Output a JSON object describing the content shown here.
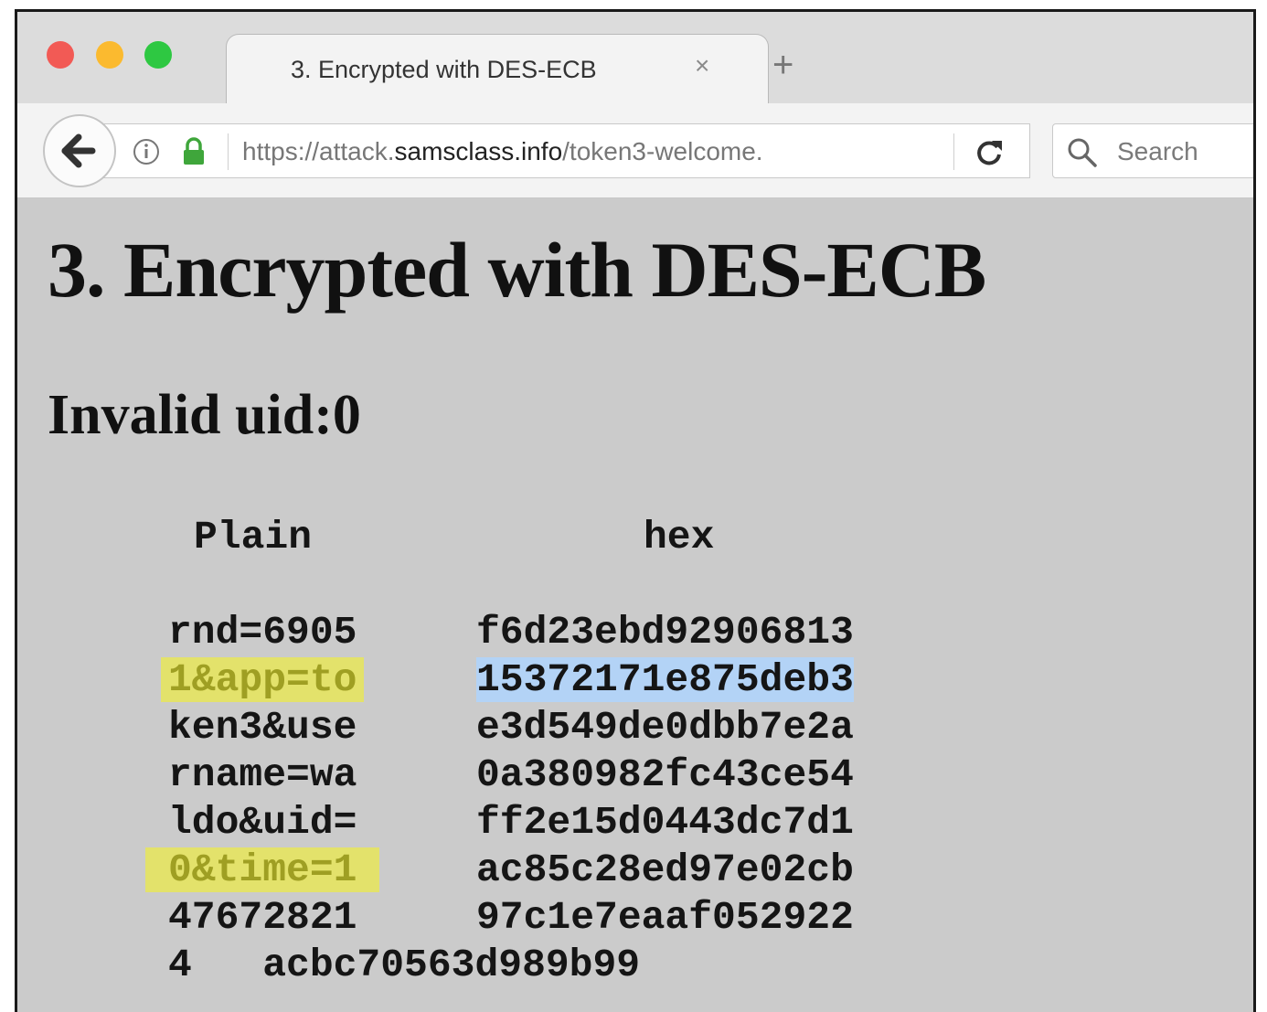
{
  "browser": {
    "tab_title": "3. Encrypted with DES-ECB",
    "tab_close": "×",
    "new_tab": "+",
    "url_prefix": "https://attack.",
    "url_domain": "samsclass.info",
    "url_path": "/token3-welcome.",
    "search_placeholder": "Search",
    "icons": [
      "back-arrow-icon",
      "info-icon",
      "lock-icon",
      "reload-icon",
      "search-icon",
      "close-icon",
      "plus-icon"
    ],
    "colors": {
      "close": "#f25a55",
      "minimize": "#fbba2f",
      "maximize": "#2ec842",
      "lock": "#3fa63b"
    }
  },
  "page": {
    "title": "3. Encrypted with DES-ECB",
    "message": "Invalid uid:0",
    "table": {
      "headers": {
        "plain": "Plain",
        "hex": "hex"
      },
      "rows": [
        {
          "plain": "rnd=6905",
          "hex": "f6d23ebd92906813",
          "plain_highlight": false,
          "hex_highlight": false
        },
        {
          "plain": "1&app=to",
          "hex": "15372171e875deb3",
          "plain_highlight": true,
          "hex_highlight": true
        },
        {
          "plain": "ken3&use",
          "hex": "e3d549de0dbb7e2a",
          "plain_highlight": false,
          "hex_highlight": false
        },
        {
          "plain": "rname=wa",
          "hex": "0a380982fc43ce54",
          "plain_highlight": false,
          "hex_highlight": false
        },
        {
          "plain": "ldo&uid=",
          "hex": "ff2e15d0443dc7d1",
          "plain_highlight": false,
          "hex_highlight": false
        },
        {
          "plain": "0&time=1",
          "hex": "ac85c28ed97e02cb",
          "plain_highlight": true,
          "hex_highlight": false
        },
        {
          "plain": "47672821",
          "hex": "97c1e7eaaf052922",
          "plain_highlight": false,
          "hex_highlight": false
        },
        {
          "plain": "4   acbc70563d989b99",
          "hex": "",
          "plain_highlight": false,
          "hex_highlight": false
        }
      ],
      "highlight_colors": {
        "yellow": "#e3e26b",
        "blue": "#b3d3f6"
      }
    }
  }
}
